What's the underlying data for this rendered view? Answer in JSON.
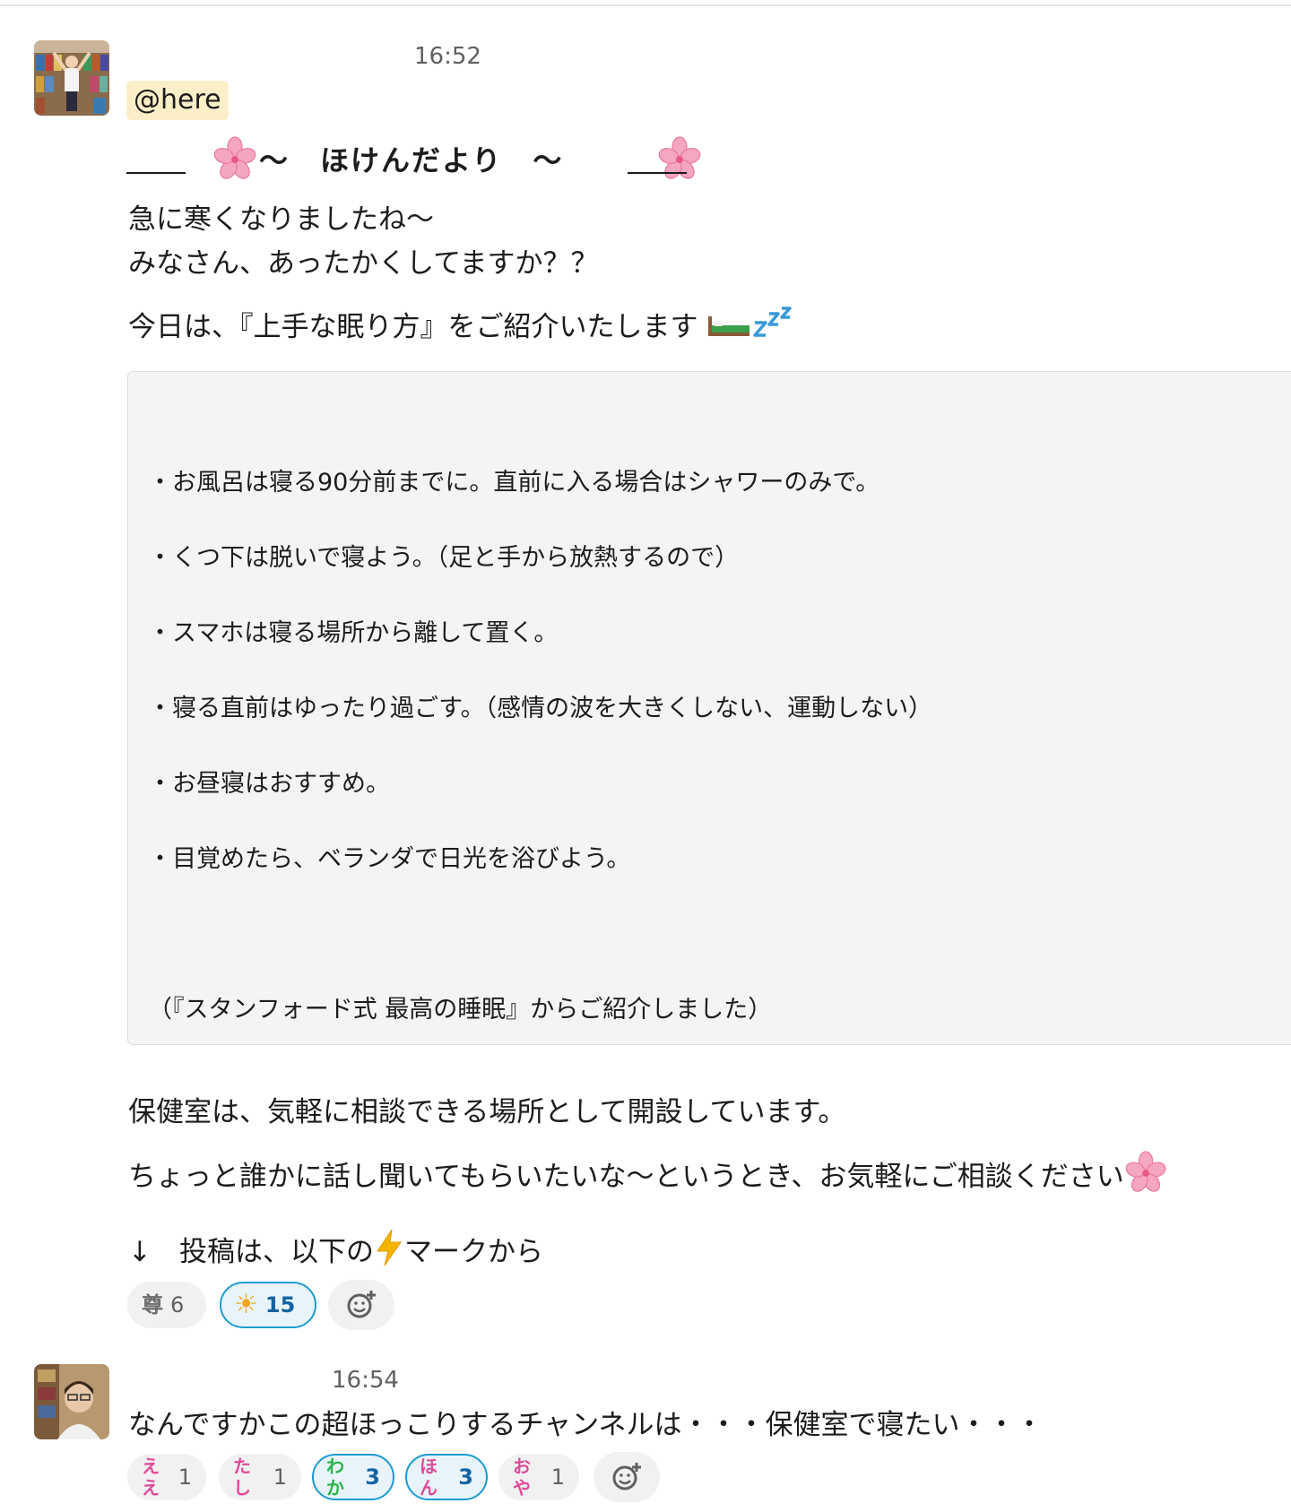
{
  "message1": {
    "time": "16:52",
    "mention": "@here",
    "title": "〜　ほけんだより　〜",
    "lines": [
      "急に寒くなりましたね〜",
      "みなさん、あったかくしてますか？？",
      "今日は、『上手な眠り方』をご紹介いたします"
    ],
    "quote": [
      "・お風呂は寝る90分前までに。直前に入る場合はシャワーのみで。",
      "・くつ下は脱いで寝よう。（足と手から放熱するので）",
      "・スマホは寝る場所から離して置く。",
      "・寝る直前はゆったり過ごす。（感情の波を大きくしない、運動しない）",
      "・お昼寝はおすすめ。",
      "・目覚めたら、ベランダで日光を浴びよう。",
      "（『スタンフォード式 最高の睡眠』からご紹介しました）"
    ],
    "after": [
      "保健室は、気軽に相談できる場所として開設しています。",
      "ちょっと誰かに話し聞いてもらいたいな〜というとき、お気軽にご相談ください",
      "↓　投稿は、以下の",
      "マークから"
    ],
    "reactions": [
      {
        "emoji": "尊",
        "count": "6",
        "active": false,
        "color": "#6b6b6b"
      },
      {
        "emoji": "☀",
        "count": "15",
        "active": true,
        "color": "#f2a51a"
      }
    ]
  },
  "message2": {
    "time": "16:54",
    "text": "なんですかこの超ほっこりするチャンネルは・・・保健室で寝たい・・・",
    "reactions": [
      {
        "emoji": "ええ",
        "count": "1",
        "active": false,
        "color": "#e04a9a"
      },
      {
        "emoji": "たし",
        "count": "1",
        "active": false,
        "color": "#e04a9a"
      },
      {
        "emoji": "わか",
        "count": "3",
        "active": true,
        "color": "#2bb24c"
      },
      {
        "emoji": "ほん",
        "count": "3",
        "active": true,
        "color": "#e04a9a"
      },
      {
        "emoji": "おや",
        "count": "1",
        "active": false,
        "color": "#e04a9a"
      }
    ]
  }
}
